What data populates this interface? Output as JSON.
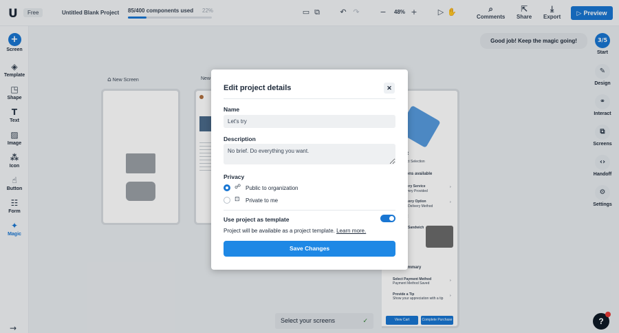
{
  "topbar": {
    "logo": "U",
    "plan_badge": "Free",
    "project_name": "Untitled Blank Project",
    "usage_text": "85/400 components used",
    "usage_percent": "22%",
    "usage_fraction": 0.22,
    "zoom": "48%",
    "comments": "Comments",
    "share": "Share",
    "export": "Export",
    "preview": "Preview"
  },
  "left_sidebar": {
    "items": [
      {
        "label": "Screen",
        "icon": "plus-icon"
      },
      {
        "label": "Template",
        "icon": "layers-icon"
      },
      {
        "label": "Shape",
        "icon": "shapes-icon"
      },
      {
        "label": "Text",
        "icon": "text-icon"
      },
      {
        "label": "Image",
        "icon": "image-icon"
      },
      {
        "label": "Icon",
        "icon": "icon-grid-icon"
      },
      {
        "label": "Button",
        "icon": "button-icon"
      },
      {
        "label": "Form",
        "icon": "form-icon"
      },
      {
        "label": "Magic",
        "icon": "sparkle-icon"
      }
    ]
  },
  "right_sidebar": {
    "progress": "3/5",
    "items": [
      {
        "label": "Start"
      },
      {
        "label": "Design"
      },
      {
        "label": "Interact"
      },
      {
        "label": "Screens"
      },
      {
        "label": "Handoff"
      },
      {
        "label": "Settings"
      }
    ]
  },
  "toast": "Good job! Keep the magic going!",
  "canvas": {
    "screen1_label": "New Screen",
    "screen2_label": "New",
    "mini_text": {
      "cart": "rt",
      "product_selection": "uct Selection",
      "options": "ions available",
      "delivery_service": "very Service",
      "delivery_sub": "livery Provided",
      "delivery_option": "livery Option",
      "delivery_method": "e Delivery Method",
      "cart2": "rt",
      "sandwich": "Sandwich",
      "summary": "ummary",
      "payment": "Select Payment Method",
      "payment_sub": "Payment Method Saved",
      "tip": "Provide a Tip",
      "tip_sub": "Show your appreciation with a tip",
      "view_cart": "View Cart",
      "complete": "Complete Purchase"
    }
  },
  "select_bar": "Select your screens",
  "modal": {
    "title": "Edit project details",
    "name_label": "Name",
    "name_value": "Let's try",
    "description_label": "Description",
    "description_value": "No brief. Do everything you want.",
    "privacy_label": "Privacy",
    "public_label": "Public to organization",
    "private_label": "Private to me",
    "template_label": "Use project as template",
    "template_desc": "Project will be available as a project template.",
    "learn_more": "Learn more.",
    "save": "Save Changes"
  }
}
